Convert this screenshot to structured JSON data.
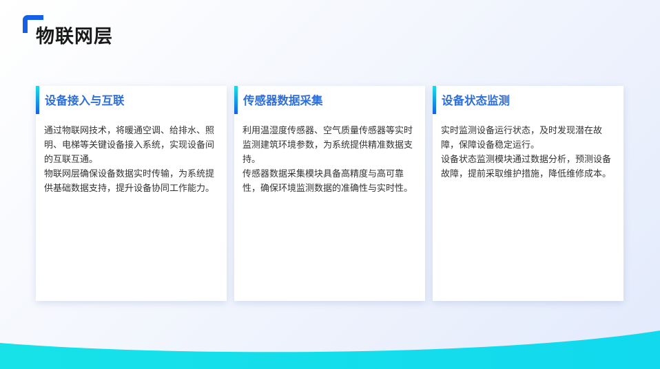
{
  "page": {
    "title": "物联网层"
  },
  "colors": {
    "accent_blue": "#1560e6",
    "accent_cyan": "#17e0e8",
    "card_title": "#2f6fd8"
  },
  "cards": [
    {
      "title": "设备接入与互联",
      "paragraphs": [
        "通过物联网技术，将暖通空调、给排水、照明、电梯等关键设备接入系统，实现设备间的互联互通。",
        "物联网层确保设备数据实时传输，为系统提供基础数据支持，提升设备协同工作能力。"
      ]
    },
    {
      "title": "传感器数据采集",
      "paragraphs": [
        "利用温湿度传感器、空气质量传感器等实时监测建筑环境参数，为系统提供精准数据支持。",
        "传感器数据采集模块具备高精度与高可靠性，确保环境监测数据的准确性与实时性。"
      ]
    },
    {
      "title": "设备状态监测",
      "paragraphs": [
        "实时监测设备运行状态，及时发现潜在故障，保障设备稳定运行。",
        "设备状态监测模块通过数据分析，预测设备故障，提前采取维护措施，降低维修成本。"
      ]
    }
  ]
}
